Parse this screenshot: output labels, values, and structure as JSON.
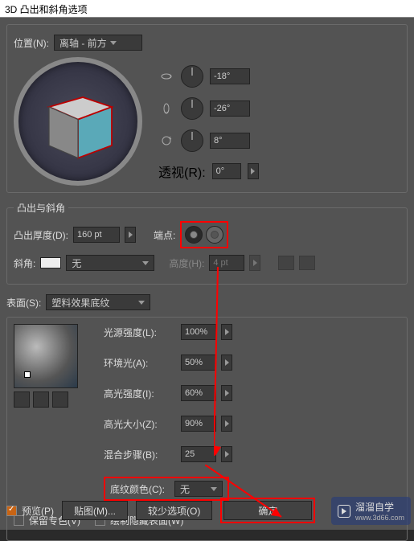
{
  "title": "3D 凸出和斜角选项",
  "position_section": {
    "label": "位置(N):",
    "value": "离轴 - 前方",
    "rot_x": "-18°",
    "rot_y": "-26°",
    "rot_z": "8°",
    "perspective_label": "透视(R):",
    "perspective_value": "0°"
  },
  "extrude_section": {
    "legend": "凸出与斜角",
    "depth_label": "凸出厚度(D):",
    "depth_value": "160 pt",
    "cap_label": "端点:",
    "bevel_label": "斜角:",
    "bevel_value": "无",
    "height_label": "高度(H):",
    "height_value": "4 pt"
  },
  "surface": {
    "label": "表面(S):",
    "value": "塑料效果底纹",
    "light_intensity_label": "光源强度(L):",
    "light_intensity_value": "100%",
    "ambient_label": "环境光(A):",
    "ambient_value": "50%",
    "highlight_intensity_label": "高光强度(I):",
    "highlight_intensity_value": "60%",
    "highlight_size_label": "高光大小(Z):",
    "highlight_size_value": "90%",
    "blend_label": "混合步骤(B):",
    "blend_value": "25",
    "shading_color_label": "底纹颜色(C):",
    "shading_color_value": "无"
  },
  "checkboxes": {
    "preserve_label": "保留专色(V)",
    "hidden_label": "绘制隐藏表面(W)"
  },
  "bottom": {
    "preview_label": "预览(P)",
    "map_btn": "贴图(M)...",
    "less_btn": "较少选项(O)",
    "ok_btn": "确定"
  },
  "watermark": {
    "text": "溜溜自学",
    "url": "www.3d66.com"
  }
}
